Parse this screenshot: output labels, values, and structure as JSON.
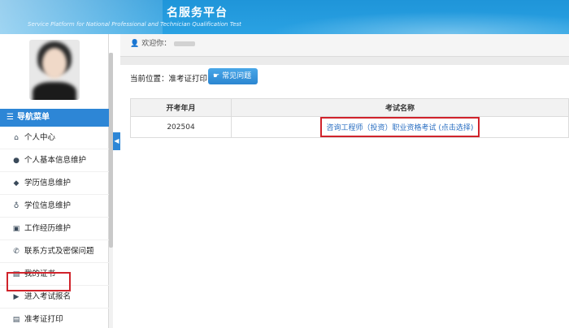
{
  "header": {
    "title": "名服务平台",
    "subtitle": "Service Platform for National Professional and Technician Qualification Test"
  },
  "sidebar": {
    "nav_title": "导航菜单",
    "items": [
      {
        "label": "个人中心",
        "icon": "home-icon",
        "glyph": "⌂"
      },
      {
        "label": "个人基本信息维护",
        "icon": "user-icon",
        "glyph": "●"
      },
      {
        "label": "学历信息维护",
        "icon": "graduation-cap-icon",
        "glyph": "◆"
      },
      {
        "label": "学位信息维护",
        "icon": "medal-icon",
        "glyph": "♁"
      },
      {
        "label": "工作经历维护",
        "icon": "briefcase-icon",
        "glyph": "▣"
      },
      {
        "label": "联系方式及密保问题",
        "icon": "phone-icon",
        "glyph": "✆"
      },
      {
        "label": "我的证书",
        "icon": "certificate-icon",
        "glyph": "▤"
      },
      {
        "label": "进入考试报名",
        "icon": "play-circle-icon",
        "glyph": "▶"
      },
      {
        "label": "准考证打印",
        "icon": "print-icon",
        "glyph": "▤"
      }
    ]
  },
  "welcome": {
    "label": "欢迎你："
  },
  "breadcrumb": {
    "text": "当前位置：准考证打印"
  },
  "faq_button": {
    "label": "常见问题"
  },
  "table": {
    "headers": [
      "开考年月",
      "考试名称"
    ],
    "rows": [
      {
        "year_month": "202504",
        "exam_name": "咨询工程师（投资）职业资格考试 (点击选择)"
      }
    ]
  },
  "colors": {
    "header_blue": "#1f95d9",
    "nav_blue": "#2d86d6",
    "link_blue": "#2b6fc2",
    "highlight_red": "#d0232b"
  }
}
